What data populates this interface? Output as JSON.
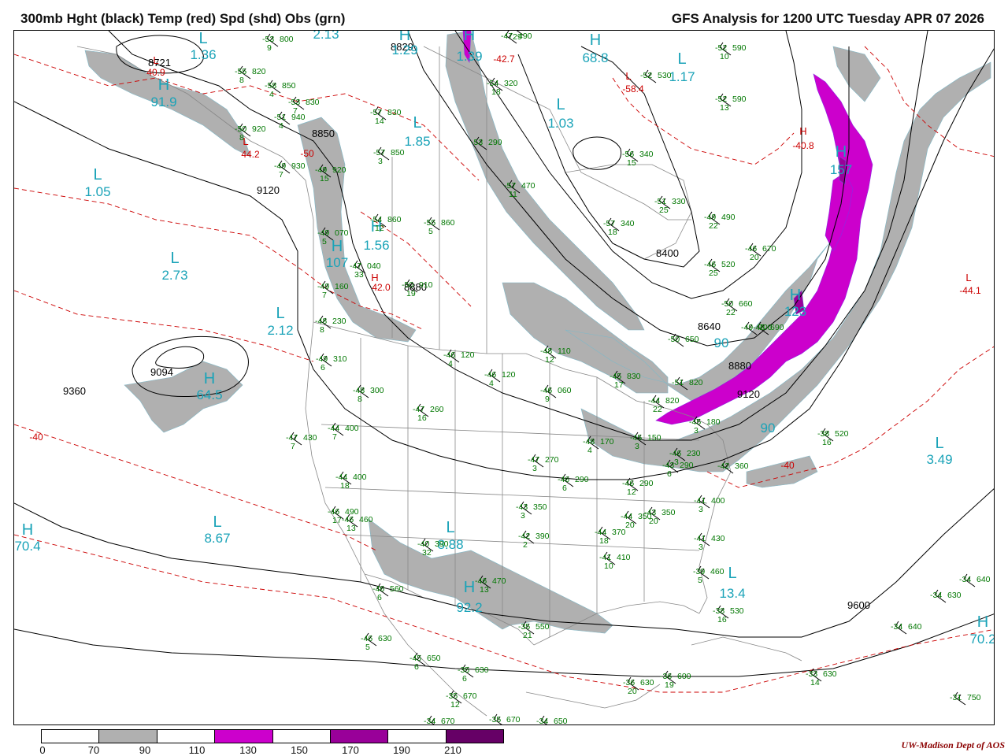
{
  "header": {
    "left_title": "300mb Hght (black) Temp (red) Spd (shd) Obs (grn)",
    "right_title": "GFS Analysis for 1200 UTC Tuesday  APR 07 2026"
  },
  "colorbar": {
    "labels": [
      "0",
      "70",
      "90",
      "110",
      "130",
      "150",
      "170",
      "190",
      "210"
    ],
    "colors": [
      "#ffffff",
      "#b0b0b0",
      "#ffffff",
      "#cc00cc",
      "#ffffff",
      "#990099",
      "#ffffff",
      "#660066"
    ]
  },
  "credit": "UW-Madison  Dept of AOS",
  "colors": {
    "height": "#000000",
    "temperature": "#cc0000",
    "obs": "#007700",
    "speed_label": "#1aa3b8",
    "shade_70": "#b0b0b0",
    "shade_110": "#cc00cc",
    "shade_150": "#990099",
    "border": "#888888"
  },
  "height_labels": [
    "8721",
    "8829",
    "8850",
    "9120",
    "8400",
    "8640",
    "8880",
    "9094",
    "9360",
    "9120",
    "9600",
    "8880"
  ],
  "speed_centers": [
    {
      "type": "L",
      "value": "1.36"
    },
    {
      "type": "H",
      "value": "91.9"
    },
    {
      "type": "L",
      "value": "1.05"
    },
    {
      "type": "L",
      "value": "2.73"
    },
    {
      "type": "L",
      "value": "2.12"
    },
    {
      "type": "H",
      "value": "64.5"
    },
    {
      "type": "L",
      "value": "1.85"
    },
    {
      "type": "H",
      "value": "1.56"
    },
    {
      "type": "H",
      "value": "107"
    },
    {
      "type": "L",
      "value": "1.03"
    },
    {
      "type": "H",
      "value": "68.8"
    },
    {
      "type": "L",
      "value": "1.17"
    },
    {
      "type": "H",
      "value": "157"
    },
    {
      "type": "H",
      "value": "123"
    },
    {
      "type": "L",
      "value": "3.49"
    },
    {
      "type": "L",
      "value": "8.67"
    },
    {
      "type": "L",
      "value": "8.88"
    },
    {
      "type": "H",
      "value": "92.2"
    },
    {
      "type": "L",
      "value": "13.4"
    },
    {
      "type": "H",
      "value": "70.4"
    },
    {
      "type": "H",
      "value": "70.2"
    },
    {
      "type": "H",
      "value": "1.29"
    },
    {
      "type": "H",
      "value": "2.13"
    },
    {
      "type": "H",
      "value": "1.39"
    },
    {
      "type": "",
      "value": "90"
    },
    {
      "type": "",
      "value": "90"
    }
  ],
  "temp_centers": [
    {
      "type": "L",
      "value": "40.9"
    },
    {
      "type": "L",
      "value": "44.2"
    },
    {
      "type": "L",
      "value": "-58.4"
    },
    {
      "type": "H",
      "value": "-40.8"
    },
    {
      "type": "H",
      "value": "42.0"
    },
    {
      "type": "L",
      "value": "-44.1"
    },
    {
      "type": "",
      "value": "-40"
    },
    {
      "type": "",
      "value": "-40"
    },
    {
      "type": "",
      "value": "-50"
    },
    {
      "type": "",
      "value": "-42.7"
    }
  ],
  "observations": [
    {
      "t": "-53",
      "h": "800",
      "d": "9"
    },
    {
      "t": "-55",
      "h": "820",
      "d": "8"
    },
    {
      "t": "-58",
      "h": "850",
      "d": "4"
    },
    {
      "t": "-53",
      "h": "830",
      "d": "7"
    },
    {
      "t": "-51",
      "h": "940",
      "d": "4"
    },
    {
      "t": "-50",
      "h": "920",
      "d": "8"
    },
    {
      "t": "-49",
      "h": "930",
      "d": "7"
    },
    {
      "t": "-49",
      "h": "920",
      "d": "15"
    },
    {
      "t": "-57",
      "h": "830",
      "d": "14"
    },
    {
      "t": "-57",
      "h": "850",
      "d": "3"
    },
    {
      "t": "-54",
      "h": "860",
      "d": "12"
    },
    {
      "t": "-55",
      "h": "860",
      "d": "5"
    },
    {
      "t": "-49",
      "h": "070",
      "d": "5"
    },
    {
      "t": "-47",
      "h": "040",
      "d": "33"
    },
    {
      "t": "-50",
      "h": "910",
      "d": "19"
    },
    {
      "t": "-49",
      "h": "160",
      "d": "7"
    },
    {
      "t": "-48",
      "h": "230",
      "d": "8"
    },
    {
      "t": "-49",
      "h": "310",
      "d": "6"
    },
    {
      "t": "-48",
      "h": "300",
      "d": "8"
    },
    {
      "t": "-44",
      "h": "400",
      "d": "7"
    },
    {
      "t": "-47",
      "h": "430",
      "d": "7"
    },
    {
      "t": "-47",
      "h": "260",
      "d": "16"
    },
    {
      "t": "-44",
      "h": "400",
      "d": "18"
    },
    {
      "t": "-46",
      "h": "490",
      "d": "17"
    },
    {
      "t": "-46",
      "h": "460",
      "d": "13"
    },
    {
      "t": "-40",
      "h": "390",
      "d": "32"
    },
    {
      "t": "-46",
      "h": "560",
      "d": "6"
    },
    {
      "t": "-46",
      "h": "470",
      "d": "13"
    },
    {
      "t": "-46",
      "h": "630",
      "d": "5"
    },
    {
      "t": "-45",
      "h": "650",
      "d": "6"
    },
    {
      "t": "-35",
      "h": "630",
      "d": "6"
    },
    {
      "t": "-35",
      "h": "670",
      "d": "12"
    },
    {
      "t": "-34",
      "h": "670",
      "d": ""
    },
    {
      "t": "-35",
      "h": "670",
      "d": ""
    },
    {
      "t": "-34",
      "h": "650",
      "d": ""
    },
    {
      "t": "-35",
      "h": "550",
      "d": "21"
    },
    {
      "t": "-36",
      "h": "630",
      "d": "20"
    },
    {
      "t": "-36",
      "h": "600",
      "d": "19"
    },
    {
      "t": "-46",
      "h": "120",
      "d": "4"
    },
    {
      "t": "-46",
      "h": "120",
      "d": "4"
    },
    {
      "t": "-48",
      "h": "110",
      "d": "12"
    },
    {
      "t": "-46",
      "h": "060",
      "d": "9"
    },
    {
      "t": "-47",
      "h": "270",
      "d": "3"
    },
    {
      "t": "-46",
      "h": "290",
      "d": "6"
    },
    {
      "t": "-43",
      "h": "350",
      "d": "3"
    },
    {
      "t": "-42",
      "h": "390",
      "d": "2"
    },
    {
      "t": "-44",
      "h": "370",
      "d": "18"
    },
    {
      "t": "-41",
      "h": "410",
      "d": "10"
    },
    {
      "t": "-46",
      "h": "290",
      "d": "12"
    },
    {
      "t": "-44",
      "h": "350",
      "d": "20"
    },
    {
      "t": "-43",
      "h": "350",
      "d": "20"
    },
    {
      "t": "-41",
      "h": "400",
      "d": "3"
    },
    {
      "t": "-41",
      "h": "430",
      "d": "3"
    },
    {
      "t": "-39",
      "h": "460",
      "d": "5"
    },
    {
      "t": "-38",
      "h": "530",
      "d": "16"
    },
    {
      "t": "-38",
      "h": "520",
      "d": "16"
    },
    {
      "t": "-34",
      "h": "640",
      "d": ""
    },
    {
      "t": "-34",
      "h": "630",
      "d": ""
    },
    {
      "t": "-34",
      "h": "640",
      "d": ""
    },
    {
      "t": "-33",
      "h": "630",
      "d": "14"
    },
    {
      "t": "-31",
      "h": "750",
      "d": ""
    },
    {
      "t": "-48",
      "h": "170",
      "d": "4"
    },
    {
      "t": "-45",
      "h": "150",
      "d": "3"
    },
    {
      "t": "-46",
      "h": "230",
      "d": "3"
    },
    {
      "t": "-43",
      "h": "290",
      "d": "6"
    },
    {
      "t": "-42",
      "h": "360",
      "d": ""
    },
    {
      "t": "-45",
      "h": "180",
      "d": "3"
    },
    {
      "t": "-45",
      "h": "830",
      "d": "17"
    },
    {
      "t": "-44",
      "h": "820",
      "d": "22"
    },
    {
      "t": "-50",
      "h": "650",
      "d": ""
    },
    {
      "t": "-51",
      "h": "820",
      "d": ""
    },
    {
      "t": "-52",
      "h": "590",
      "d": "10"
    },
    {
      "t": "-52",
      "h": "590",
      "d": "13"
    },
    {
      "t": "-52",
      "h": "530",
      "d": ""
    },
    {
      "t": "-56",
      "h": "340",
      "d": "15"
    },
    {
      "t": "-51",
      "h": "330",
      "d": "25"
    },
    {
      "t": "-57",
      "h": "340",
      "d": "18"
    },
    {
      "t": "-57",
      "h": "470",
      "d": "11"
    },
    {
      "t": "-49",
      "h": "490",
      "d": "22"
    },
    {
      "t": "-46",
      "h": "520",
      "d": "25"
    },
    {
      "t": "-46",
      "h": "670",
      "d": "20"
    },
    {
      "t": "-50",
      "h": "660",
      "d": "22"
    },
    {
      "t": "-49",
      "h": "700",
      "d": ""
    },
    {
      "t": "-48",
      "h": "690",
      "d": ""
    },
    {
      "t": "-53",
      "h": "290",
      "d": ""
    },
    {
      "t": "-54",
      "h": "320",
      "d": "18"
    },
    {
      "t": "-47",
      "h": "490",
      "d": ""
    },
    {
      "t": "-54",
      "h": "280",
      "d": "29"
    }
  ]
}
